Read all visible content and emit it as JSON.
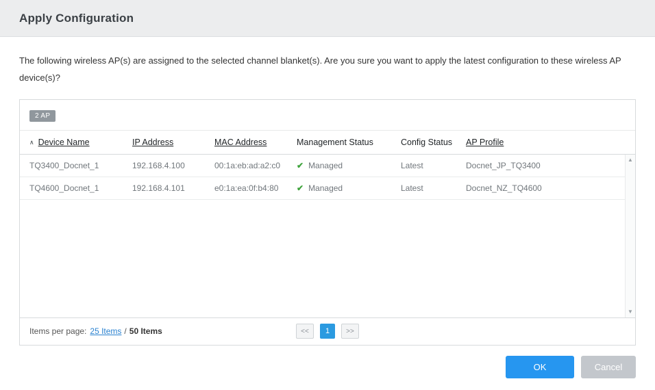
{
  "dialog": {
    "title": "Apply Configuration",
    "message": "The following wireless AP(s) are assigned to the selected channel blanket(s). Are you sure you want to apply the latest configuration to these wireless AP device(s)?"
  },
  "table": {
    "badge": "2 AP",
    "sort_indicator": "∧",
    "columns": [
      "Device Name",
      "IP Address",
      "MAC Address",
      "Management Status",
      "Config Status",
      "AP Profile"
    ],
    "rows": [
      {
        "device_name": "TQ3400_Docnet_1",
        "ip_address": "192.168.4.100",
        "mac_address": "00:1a:eb:ad:a2:c0",
        "management_status": "Managed",
        "config_status": "Latest",
        "ap_profile": "Docnet_JP_TQ3400"
      },
      {
        "device_name": "TQ4600_Docnet_1",
        "ip_address": "192.168.4.101",
        "mac_address": "e0:1a:ea:0f:b4:80",
        "management_status": "Managed",
        "config_status": "Latest",
        "ap_profile": "Docnet_NZ_TQ4600"
      }
    ]
  },
  "pagination": {
    "items_per_page_label": "Items per page:",
    "items_per_page_link": "25 Items",
    "separator": "/",
    "total_items": "50 Items",
    "first_button": "<<",
    "current_page": "1",
    "last_button": ">>"
  },
  "actions": {
    "ok_label": "OK",
    "cancel_label": "Cancel"
  },
  "colors": {
    "accent_blue": "#2696f0",
    "success_green": "#3fa33c",
    "badge_gray": "#90979d",
    "cancel_gray": "#c3c7cc"
  }
}
